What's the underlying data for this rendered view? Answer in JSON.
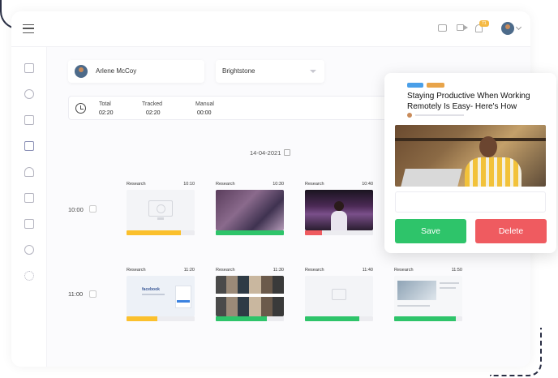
{
  "colors": {
    "accent_green": "#2ec46a",
    "accent_red": "#ef5b60",
    "accent_yellow": "#fbc02d",
    "notification": "#f5b942"
  },
  "header": {
    "notification_count": "71",
    "icons": [
      "hamburger-icon",
      "chat-icon",
      "video-icon",
      "bell-icon",
      "avatar",
      "chevron-down-icon"
    ]
  },
  "sidebar": {
    "icons": [
      "dashboard-icon",
      "clock-icon",
      "document-icon",
      "screenshot-icon",
      "users-icon",
      "briefcase-icon",
      "report-icon",
      "timer-icon",
      "gear-icon"
    ],
    "active_index": 3
  },
  "filters": {
    "employee": "Arlene McCoy",
    "team": "Brightstone"
  },
  "summary": {
    "total_label": "Total",
    "total_value": "02:20",
    "tracked_label": "Tracked",
    "tracked_value": "02:20",
    "manual_label": "Manual",
    "manual_value": "00:00"
  },
  "date": "14-04-2021",
  "rows": [
    {
      "time": "10:00",
      "cards": [
        {
          "title": "Research",
          "time": "10:10",
          "progress": 0.8,
          "color": "#fbc02d",
          "thumb": "empty-monitor"
        },
        {
          "title": "Research",
          "time": "10:30",
          "progress": 1.0,
          "color": "#2ec46a",
          "thumb": "blurred"
        },
        {
          "title": "Research",
          "time": "10:40",
          "progress": 0.25,
          "color": "#ef5b60",
          "thumb": "presentation"
        }
      ]
    },
    {
      "time": "11:00",
      "cards": [
        {
          "title": "Research",
          "time": "11:20",
          "progress": 0.45,
          "color": "#fbc02d",
          "thumb": "facebook"
        },
        {
          "title": "Research",
          "time": "11:30",
          "progress": 0.75,
          "color": "#2ec46a",
          "thumb": "gallery"
        },
        {
          "title": "Research",
          "time": "11:40",
          "progress": 0.8,
          "color": "#2ec46a",
          "thumb": "empty-image"
        },
        {
          "title": "Research",
          "time": "11:50",
          "progress": 0.9,
          "color": "#2ec46a",
          "thumb": "article"
        }
      ]
    }
  ],
  "thumb_text": {
    "facebook": "facebook"
  },
  "detail": {
    "tags": [
      {
        "label": "",
        "color": "#4a9fe8"
      },
      {
        "label": "",
        "color": "#e8a44a"
      }
    ],
    "title": "Staying Productive When Working Remotely Is Easy- Here's How",
    "save_label": "Save",
    "delete_label": "Delete"
  }
}
